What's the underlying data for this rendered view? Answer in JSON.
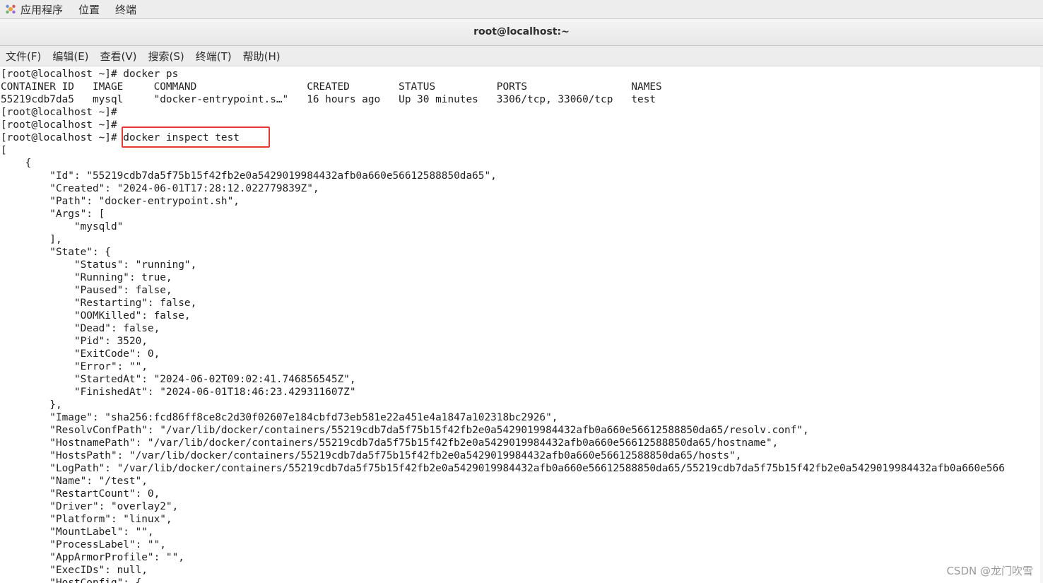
{
  "top_bar": {
    "menus": [
      "应用程序",
      "位置",
      "终端"
    ]
  },
  "window": {
    "title": "root@localhost:~"
  },
  "menubar": {
    "items": [
      "文件(F)",
      "编辑(E)",
      "查看(V)",
      "搜索(S)",
      "终端(T)",
      "帮助(H)"
    ]
  },
  "terminal": {
    "lines": [
      "[root@localhost ~]# docker ps",
      "CONTAINER ID   IMAGE     COMMAND                  CREATED        STATUS          PORTS                 NAMES",
      "55219cdb7da5   mysql     \"docker-entrypoint.s…\"   16 hours ago   Up 30 minutes   3306/tcp, 33060/tcp   test",
      "[root@localhost ~]#",
      "[root@localhost ~]#",
      "[root@localhost ~]# docker inspect test",
      "[",
      "    {",
      "        \"Id\": \"55219cdb7da5f75b15f42fb2e0a5429019984432afb0a660e56612588850da65\",",
      "        \"Created\": \"2024-06-01T17:28:12.022779839Z\",",
      "        \"Path\": \"docker-entrypoint.sh\",",
      "        \"Args\": [",
      "            \"mysqld\"",
      "        ],",
      "        \"State\": {",
      "            \"Status\": \"running\",",
      "            \"Running\": true,",
      "            \"Paused\": false,",
      "            \"Restarting\": false,",
      "            \"OOMKilled\": false,",
      "            \"Dead\": false,",
      "            \"Pid\": 3520,",
      "            \"ExitCode\": 0,",
      "            \"Error\": \"\",",
      "            \"StartedAt\": \"2024-06-02T09:02:41.746856545Z\",",
      "            \"FinishedAt\": \"2024-06-01T18:46:23.429311607Z\"",
      "        },",
      "        \"Image\": \"sha256:fcd86ff8ce8c2d30f02607e184cbfd73eb581e22a451e4a1847a102318bc2926\",",
      "        \"ResolvConfPath\": \"/var/lib/docker/containers/55219cdb7da5f75b15f42fb2e0a5429019984432afb0a660e56612588850da65/resolv.conf\",",
      "        \"HostnamePath\": \"/var/lib/docker/containers/55219cdb7da5f75b15f42fb2e0a5429019984432afb0a660e56612588850da65/hostname\",",
      "        \"HostsPath\": \"/var/lib/docker/containers/55219cdb7da5f75b15f42fb2e0a5429019984432afb0a660e56612588850da65/hosts\",",
      "        \"LogPath\": \"/var/lib/docker/containers/55219cdb7da5f75b15f42fb2e0a5429019984432afb0a660e56612588850da65/55219cdb7da5f75b15f42fb2e0a5429019984432afb0a660e566",
      "        \"Name\": \"/test\",",
      "        \"RestartCount\": 0,",
      "        \"Driver\": \"overlay2\",",
      "        \"Platform\": \"linux\",",
      "        \"MountLabel\": \"\",",
      "        \"ProcessLabel\": \"\",",
      "        \"AppArmorProfile\": \"\",",
      "        \"ExecIDs\": null,",
      "        \"HostConfig\": {"
    ]
  },
  "watermark": "CSDN @龙门吹雪",
  "colors": {
    "highlight_box": "#e53935",
    "terminal_bg": "#ffffff",
    "terminal_fg": "#1e1e1e"
  }
}
